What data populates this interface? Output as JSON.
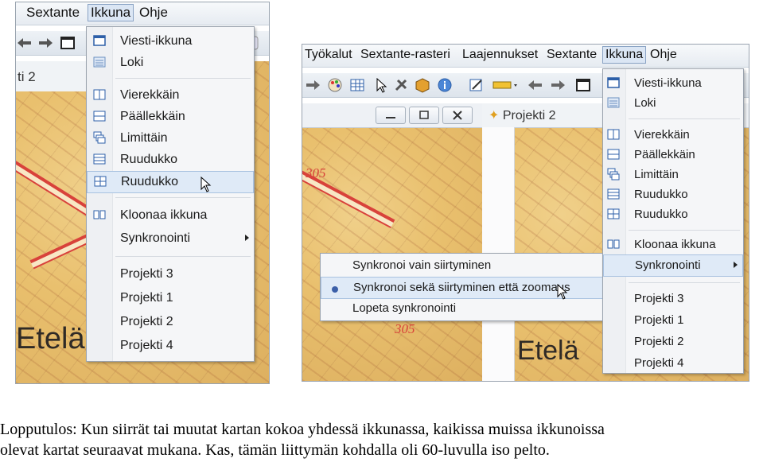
{
  "left_shot": {
    "menubar": [
      "Sextante",
      "Ikkuna",
      "Ohje"
    ],
    "tab_fragment": "ti 2",
    "map_labels": {
      "place": "Etelä"
    },
    "menu": {
      "items": [
        "Viesti-ikkuna",
        "Loki",
        "Vierekkäin",
        "Päällekkäin",
        "Limittäin",
        "Ruudukko",
        "Ruudukko",
        "Kloonaa ikkuna",
        "Synkronointi",
        "Projekti 3",
        "Projekti 1",
        "Projekti 2",
        "Projekti 4"
      ],
      "highlighted_index": 6
    }
  },
  "right_shot": {
    "menubar": [
      "Työkalut",
      "Sextante-rasteri",
      "Laajennukset",
      "Sextante",
      "Ikkuna",
      "Ohje"
    ],
    "project_tab": "Projekti 2",
    "map_labels": {
      "place": "Etelä",
      "num1": "305",
      "num2": "305"
    },
    "menu": {
      "items": [
        "Viesti-ikkuna",
        "Loki",
        "Vierekkäin",
        "Päällekkäin",
        "Limittäin",
        "Ruudukko",
        "Ruudukko",
        "Kloonaa ikkuna",
        "Synkronointi",
        "Projekti 3",
        "Projekti 1",
        "Projekti 2",
        "Projekti 4"
      ],
      "highlighted_index": 8
    },
    "submenu": {
      "items": [
        "Synkronoi vain siirtyminen",
        "Synkronoi sekä siirtyminen että zoomaus",
        "Lopeta synkronointi"
      ],
      "selected_index": 1
    }
  },
  "caption": {
    "line1": "Lopputulos: Kun siirrät tai muutat kartan kokoa yhdessä ikkunassa, kaikissa muissa ikkunoissa",
    "line2": "olevat kartat seuraavat mukana.  Kas, tämän liittymän kohdalla oli 60-luvulla iso pelto."
  },
  "colors": {
    "map_base": "#e9c06e",
    "road_red": "#d8423a",
    "menu_bg": "#f5f6f8",
    "highlight": "#dfeaf7"
  }
}
